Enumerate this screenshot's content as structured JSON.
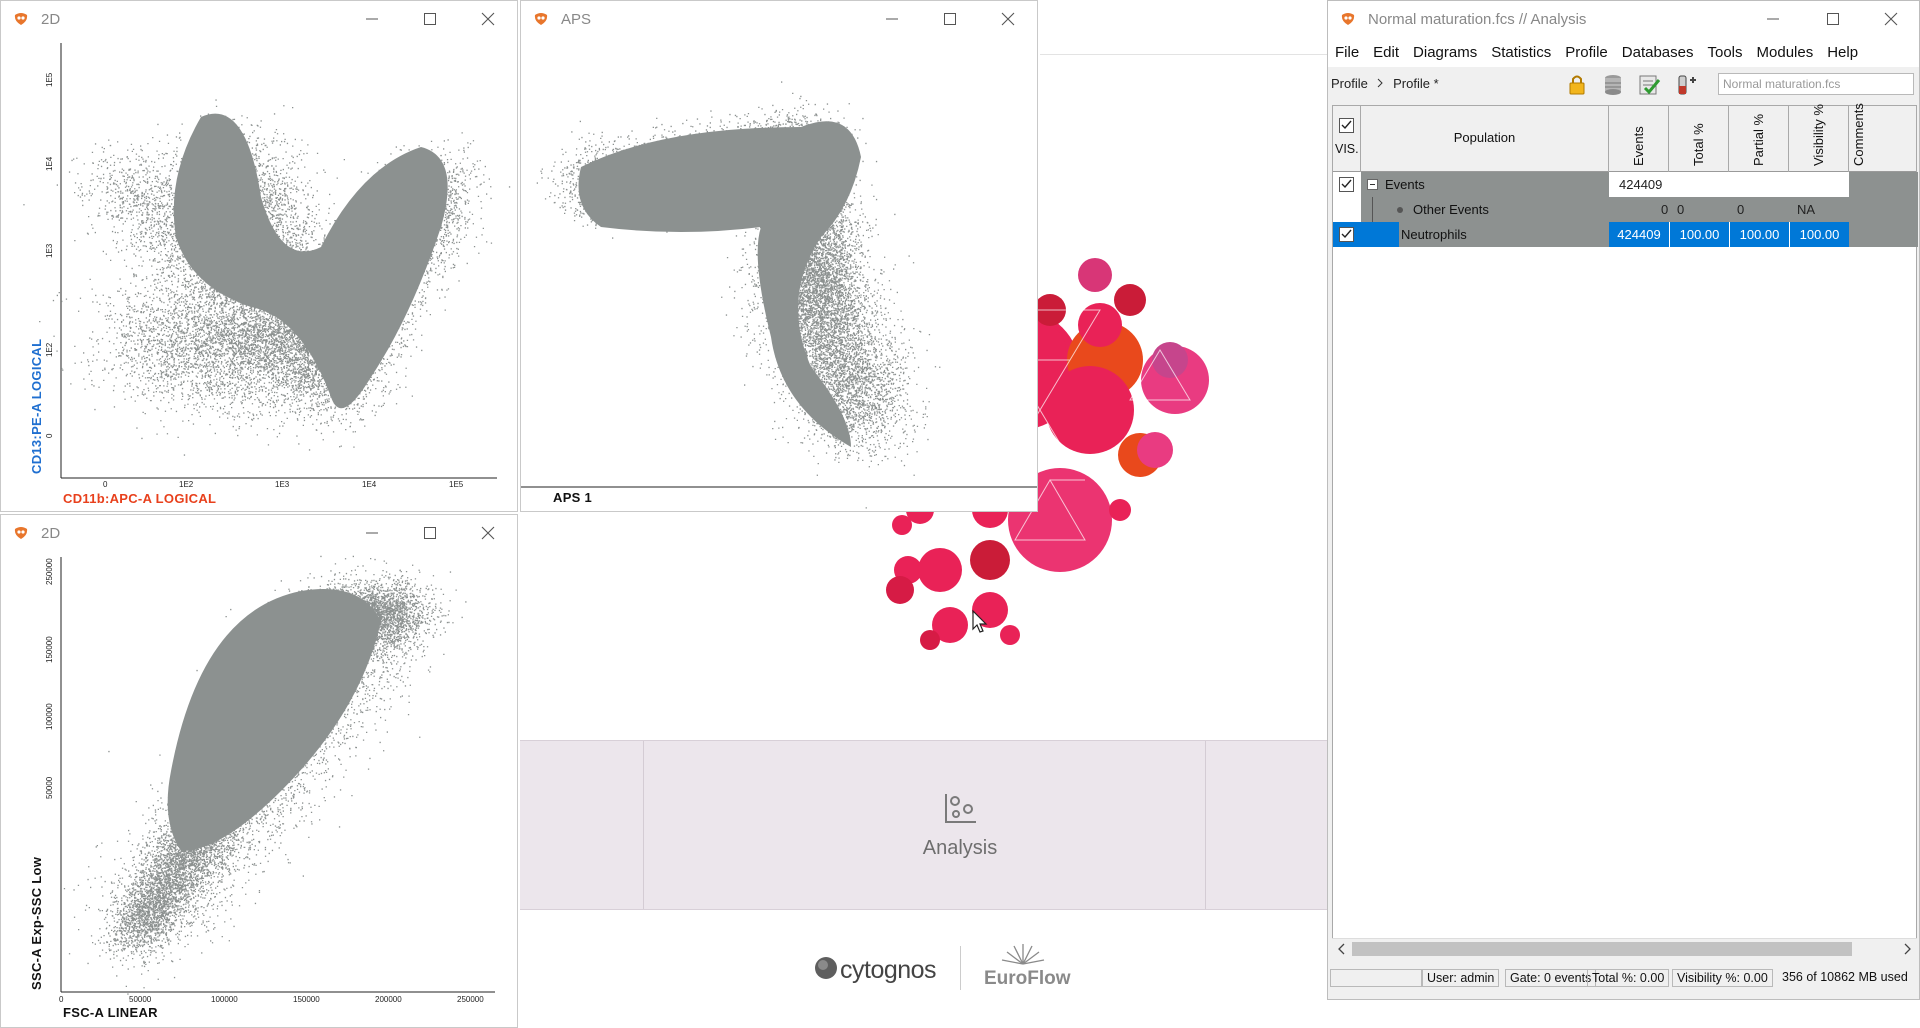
{
  "background": {
    "analysis_card_label": "Analysis",
    "cytognos_logo_text": "cytognos",
    "euroflow_logo_text": "EuroFlow"
  },
  "win_2d_top": {
    "title": "2D",
    "x_axis_label": "CD11b:APC-A LOGICAL",
    "y_axis_label": "CD13:PE-A LOGICAL",
    "x_ticks": [
      "0",
      "1E2",
      "1E3",
      "1E4",
      "1E5"
    ],
    "y_ticks": [
      "1E5",
      "1E4",
      "1E3",
      "1E2",
      "0"
    ]
  },
  "win_aps": {
    "title": "APS",
    "x_axis_label": "APS 1"
  },
  "win_2d_bottom": {
    "title": "2D",
    "x_axis_label": "FSC-A LINEAR",
    "y_axis_label": "SSC-A Exp-SSC Low",
    "x_ticks": [
      "0",
      "50000",
      "100000",
      "150000",
      "200000",
      "250000"
    ],
    "y_ticks": [
      "250000",
      "150000",
      "100000",
      "50000"
    ]
  },
  "analysis_window": {
    "title": "Normal maturation.fcs // Analysis",
    "menu": [
      "File",
      "Edit",
      "Diagrams",
      "Statistics",
      "Profile",
      "Databases",
      "Tools",
      "Modules",
      "Help"
    ],
    "breadcrumb": [
      "Profile",
      "Profile *"
    ],
    "file_select": "Normal maturation.fcs",
    "columns": {
      "vis": "VIS.",
      "population": "Population",
      "events": "Events",
      "total": "Total %",
      "partial": "Partial %",
      "visibility": "Visibility %",
      "comments": "Comments"
    },
    "rows": [
      {
        "name": "Events",
        "events": "424409",
        "total": "",
        "partial": "",
        "visibility": "",
        "checked": true,
        "selected": false
      },
      {
        "name": "Other Events",
        "events": "0",
        "total": "0",
        "partial": "0",
        "visibility": "NA",
        "checked": false,
        "selected": false
      },
      {
        "name": "Neutrophils",
        "events": "424409",
        "total": "100.00",
        "partial": "100.00",
        "visibility": "100.00",
        "checked": true,
        "selected": true
      }
    ],
    "status": {
      "user": "User: admin",
      "gate": "Gate: 0 events",
      "total": "Total %: 0.00",
      "visibility": "Visibility %: 0.00",
      "memory": "356 of 10862 MB used"
    }
  },
  "colors": {
    "scatter": "#8c9190",
    "x_label_top": "#e8401c",
    "y_label_top": "#1f6fd0",
    "selection": "#0078d7",
    "population_bg": "#8d9190"
  }
}
